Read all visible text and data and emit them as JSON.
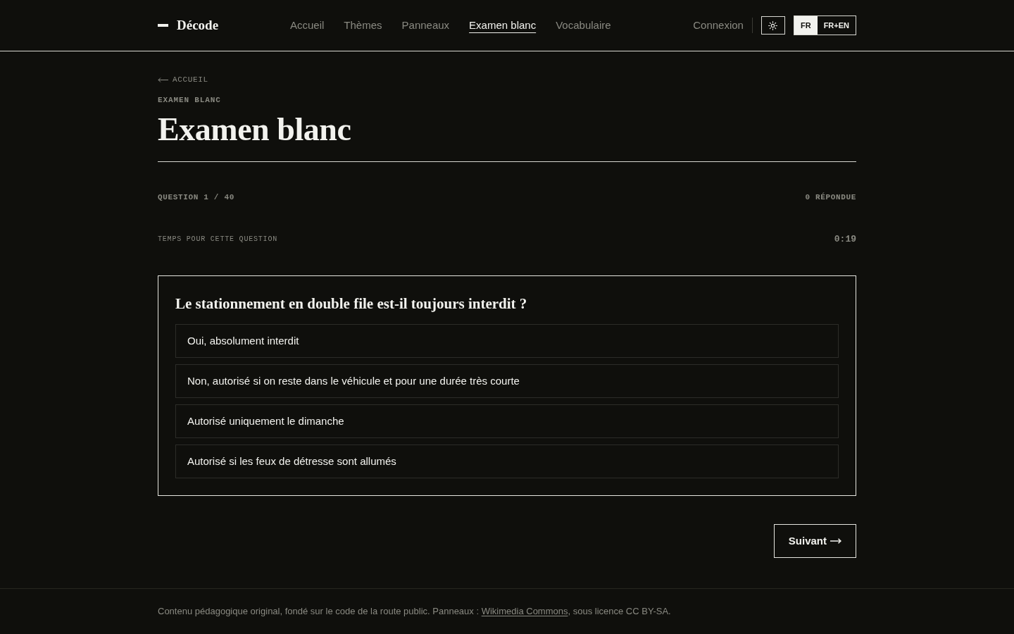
{
  "header": {
    "logo": "Décode",
    "nav": [
      {
        "label": "Accueil",
        "selected": false
      },
      {
        "label": "Thèmes",
        "selected": false
      },
      {
        "label": "Panneaux",
        "selected": false
      },
      {
        "label": "Examen blanc",
        "selected": true
      },
      {
        "label": "Vocabulaire",
        "selected": false
      }
    ],
    "login": "Connexion",
    "language_options": [
      {
        "label": "FR",
        "selected": true
      },
      {
        "label": "FR+EN",
        "selected": false
      }
    ]
  },
  "back_link": "ACCUEIL",
  "eyebrow": "EXAMEN BLANC",
  "title": "Examen blanc",
  "progress": {
    "question": "QUESTION 1 / 40",
    "answered": "0 RÉPONDUE"
  },
  "timer": {
    "label": "TEMPS POUR CETTE QUESTION",
    "value": "0:19"
  },
  "question": {
    "text": "Le stationnement en double file est-il toujours interdit ?",
    "options": [
      {
        "text": "Oui, absolument interdit",
        "selected": false
      },
      {
        "text": "Non, autorisé si on reste dans le véhicule et pour une durée très courte",
        "selected": false
      },
      {
        "text": "Autorisé uniquement le dimanche",
        "selected": false
      },
      {
        "text": "Autorisé si les feux de détresse sont allumés",
        "selected": false
      }
    ]
  },
  "next_button": "Suivant",
  "footer": {
    "text_before": "Contenu pédagogique original, fondé sur le code de la route public. Panneaux : ",
    "link": "Wikimedia Commons",
    "text_after": ", sous licence CC BY-SA."
  }
}
